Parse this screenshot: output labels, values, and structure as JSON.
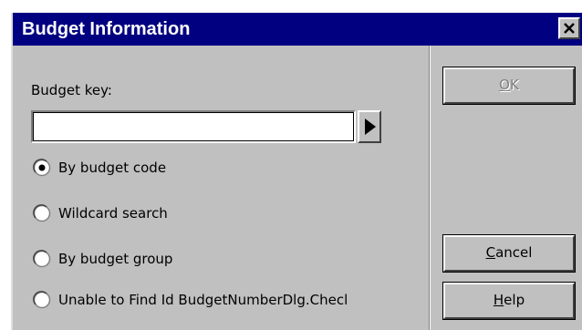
{
  "window": {
    "title": "Budget Information"
  },
  "form": {
    "budget_key_label": "Budget key:",
    "budget_key_value": "",
    "radios": [
      {
        "label": "By budget code",
        "selected": true
      },
      {
        "label": "Wildcard search",
        "selected": false
      },
      {
        "label": "By budget group",
        "selected": false
      },
      {
        "label": "Unable to Find Id BudgetNumberDlg.Checl",
        "selected": false
      }
    ]
  },
  "buttons": {
    "ok": {
      "first": "O",
      "rest": "K",
      "enabled": false
    },
    "cancel": {
      "first": "C",
      "rest": "ancel"
    },
    "help": {
      "first": "H",
      "rest": "elp"
    }
  },
  "colors": {
    "titlebar": "#000080",
    "face": "#c0c0c0",
    "disabled_text": "#808080"
  },
  "icons": {
    "close": "close-icon",
    "arrow": "triangle-right-icon",
    "radio_selected": "radio-selected-icon",
    "radio_unselected": "radio-unselected-icon"
  }
}
